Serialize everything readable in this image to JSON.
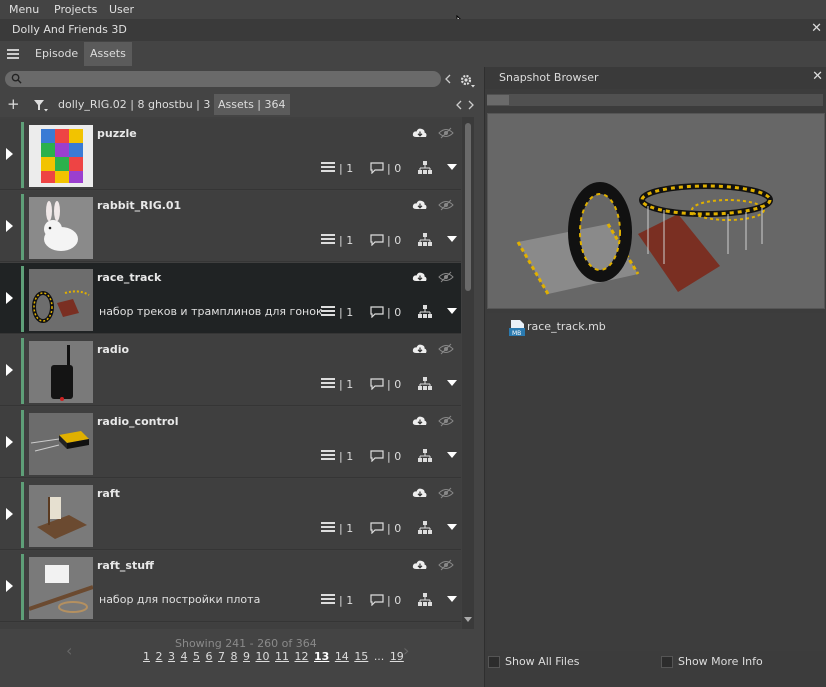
{
  "menubar": {
    "menu": "Menu",
    "projects": "Projects",
    "user": "User"
  },
  "window": {
    "title": "Dolly And Friends 3D"
  },
  "tabs": {
    "episode": "Episode",
    "assets": "Assets"
  },
  "search": {
    "placeholder": ""
  },
  "filter": {
    "crumb1": "dolly_RIG.02 | 8",
    "crumb2": "ghostbu | 3",
    "crumb3": "Assets | 364"
  },
  "assets": [
    {
      "name": "puzzle",
      "description": "",
      "versions": "| 1",
      "comments": "| 0"
    },
    {
      "name": "rabbit_RIG.01",
      "description": "",
      "versions": "| 1",
      "comments": "| 0"
    },
    {
      "name": "race_track",
      "description": "набор треков и трамплинов для гонок",
      "versions": "| 1",
      "comments": "| 0"
    },
    {
      "name": "radio",
      "description": "",
      "versions": "| 1",
      "comments": "| 0"
    },
    {
      "name": "radio_control",
      "description": "",
      "versions": "| 1",
      "comments": "| 0"
    },
    {
      "name": "raft",
      "description": "",
      "versions": "| 1",
      "comments": "| 0"
    },
    {
      "name": "raft_stuff",
      "description": "набор для постройки плота",
      "versions": "| 1",
      "comments": "| 0"
    }
  ],
  "pager": {
    "showing": "Showing 241 - 260 of 364",
    "pages": [
      "1",
      "2",
      "3",
      "4",
      "5",
      "6",
      "7",
      "8",
      "9",
      "10",
      "11",
      "12",
      "13",
      "14",
      "15",
      "...",
      "19"
    ],
    "current": "13"
  },
  "snapshot": {
    "title": "Snapshot Browser",
    "file": "race_track.mb",
    "file_badge": "MB",
    "show_all_files": "Show All Files",
    "show_more_info": "Show More Info"
  },
  "colors": {
    "accent": "#5e9f78",
    "selected_row": "#202324"
  }
}
